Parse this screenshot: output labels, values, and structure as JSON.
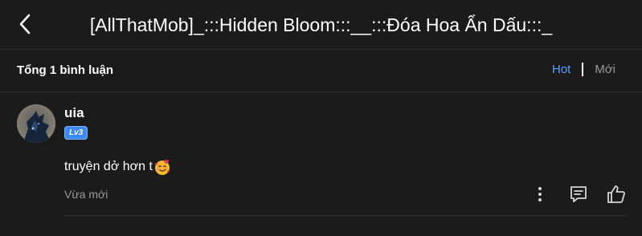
{
  "header": {
    "title": "[AllThatMob]_:::Hidden Bloom:::__:::Đóa Hoa Ẩn Dấu:::_",
    "back_icon": "chevron-left-icon"
  },
  "comments_bar": {
    "count_label": "Tổng 1 bình luận",
    "sort_options": [
      "Hot",
      "Mới"
    ],
    "active_sort": "Hot",
    "active_color": "#5aa2ff"
  },
  "comments": [
    {
      "username": "uia",
      "level": "Lv3",
      "text": "truyện dở hơn t",
      "emoji": "smiling-face-with-hearts",
      "time": "Vừa mới",
      "actions": [
        "more-icon",
        "reply-icon",
        "like-icon"
      ]
    }
  ],
  "colors": {
    "background": "#1b1b1b",
    "badge": "#3d8bf2",
    "muted": "#9a9a9a"
  }
}
